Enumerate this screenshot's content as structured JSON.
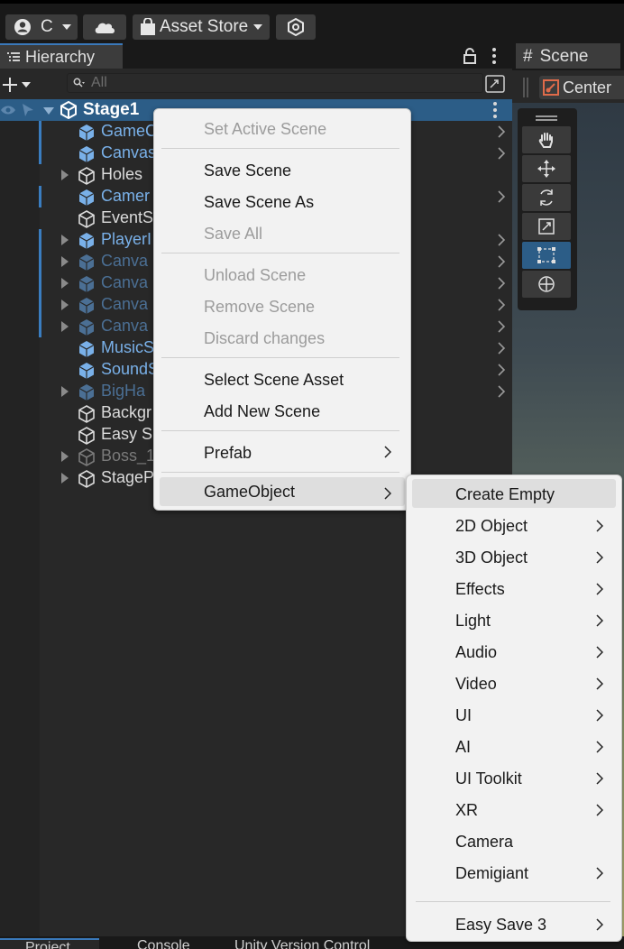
{
  "toolbar": {
    "account_label": "C",
    "asset_store_label": "Asset Store"
  },
  "hierarchy": {
    "tab_label": "Hierarchy",
    "search_placeholder": "All",
    "scene_name": "Stage1",
    "items": [
      {
        "label": "GameC",
        "style": "blue"
      },
      {
        "label": "Canvas",
        "style": "blue"
      },
      {
        "label": "Holes",
        "style": "white"
      },
      {
        "label": "Camer",
        "style": "blue"
      },
      {
        "label": "EventS",
        "style": "white"
      },
      {
        "label": "PlayerI",
        "style": "blue"
      },
      {
        "label": "Canva",
        "style": "dim"
      },
      {
        "label": "Canva",
        "style": "dim"
      },
      {
        "label": "Canva",
        "style": "dim"
      },
      {
        "label": "Canva",
        "style": "dim"
      },
      {
        "label": "MusicS",
        "style": "blue"
      },
      {
        "label": "SoundS",
        "style": "blue"
      },
      {
        "label": "BigHa",
        "style": "dim"
      },
      {
        "label": "Backgr",
        "style": "white"
      },
      {
        "label": "Easy S",
        "style": "white"
      },
      {
        "label": "Boss_1",
        "style": "gray"
      },
      {
        "label": "StageP",
        "style": "white"
      }
    ]
  },
  "scene": {
    "tab_label": "Scene",
    "pivot_label": "Center"
  },
  "bottom_tabs": [
    "Project",
    "Console",
    "Unity Version Control"
  ],
  "context_menu": {
    "set_active_scene": "Set Active Scene",
    "save_scene": "Save Scene",
    "save_scene_as": "Save Scene As",
    "save_all": "Save All",
    "unload_scene": "Unload Scene",
    "remove_scene": "Remove Scene",
    "discard_changes": "Discard changes",
    "select_scene_asset": "Select Scene Asset",
    "add_new_scene": "Add New Scene",
    "prefab": "Prefab",
    "gameobject": "GameObject"
  },
  "gameobject_submenu": {
    "create_empty": "Create Empty",
    "object_2d": "2D Object",
    "object_3d": "3D Object",
    "effects": "Effects",
    "light": "Light",
    "audio": "Audio",
    "video": "Video",
    "ui": "UI",
    "ai": "AI",
    "ui_toolkit": "UI Toolkit",
    "xr": "XR",
    "camera": "Camera",
    "demigiant": "Demigiant",
    "easy_save_3": "Easy Save 3"
  }
}
